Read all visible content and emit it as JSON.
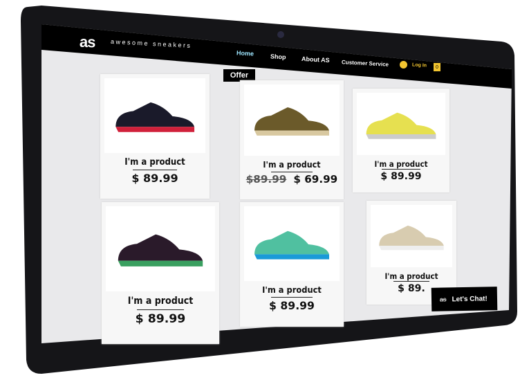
{
  "brand": {
    "logo": "as",
    "name": "awesome sneakers"
  },
  "nav": {
    "items": [
      "Home",
      "Shop",
      "About AS",
      "Customer Service"
    ],
    "login": "Log In",
    "cart_count": "0"
  },
  "offer_label": "Offer",
  "products": [
    {
      "name": "I'm a product",
      "price": "$ 89.99",
      "old_price": "",
      "shoe_color": "#1a1a2a",
      "accent": "#d0203a"
    },
    {
      "name": "I'm a product",
      "price": "$ 69.99",
      "old_price": "$89.99",
      "shoe_color": "#6b5a2a",
      "accent": "#d8c8a0"
    },
    {
      "name": "I'm a product",
      "price": "$ 89.99",
      "old_price": "",
      "shoe_color": "#e6e050",
      "accent": "#ccc"
    },
    {
      "name": "I'm a product",
      "price": "$ 89.99",
      "old_price": "",
      "shoe_color": "#2a1a2a",
      "accent": "#3aa060"
    },
    {
      "name": "I'm a product",
      "price": "$ 89.99",
      "old_price": "",
      "shoe_color": "#50c0a0",
      "accent": "#1a9ad8"
    },
    {
      "name": "I'm a product",
      "price": "$ 89.",
      "old_price": "",
      "shoe_color": "#d8ccb0",
      "accent": "#eee"
    }
  ],
  "chat": {
    "logo": "as",
    "label": "Let's Chat!"
  }
}
